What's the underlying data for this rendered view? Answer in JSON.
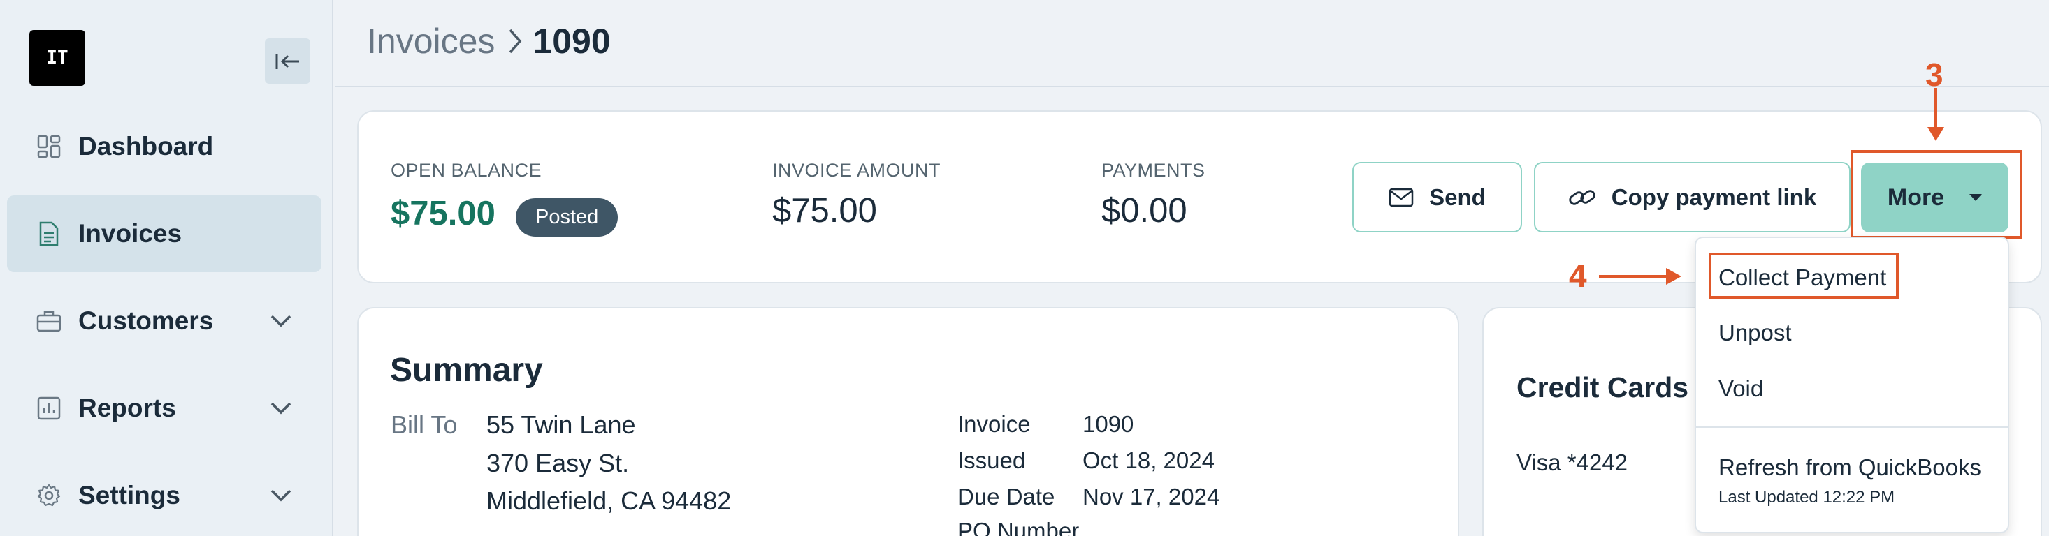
{
  "sidebar": {
    "logo_text": "IT",
    "items": [
      {
        "label": "Dashboard",
        "icon": "dashboard-icon"
      },
      {
        "label": "Invoices",
        "icon": "document-icon"
      },
      {
        "label": "Customers",
        "icon": "briefcase-icon"
      },
      {
        "label": "Reports",
        "icon": "chart-icon"
      },
      {
        "label": "Settings",
        "icon": "gear-icon"
      }
    ]
  },
  "header": {
    "breadcrumb_parent": "Invoices",
    "breadcrumb_current": "1090"
  },
  "balance": {
    "open_balance_label": "OPEN BALANCE",
    "open_balance_value": "$75.00",
    "status_badge": "Posted",
    "invoice_amount_label": "INVOICE AMOUNT",
    "invoice_amount_value": "$75.00",
    "payments_label": "PAYMENTS",
    "payments_value": "$0.00"
  },
  "actions": {
    "send_label": "Send",
    "copy_link_label": "Copy payment link",
    "more_label": "More"
  },
  "dropdown": {
    "items": [
      "Collect Payment",
      "Unpost",
      "Void",
      "Refresh from QuickBooks"
    ],
    "last_updated": "Last Updated 12:22 PM"
  },
  "annotations": {
    "step3": "3",
    "step4": "4"
  },
  "summary": {
    "title": "Summary",
    "bill_to_label": "Bill To",
    "address": [
      "55 Twin Lane",
      "370 Easy St.",
      "Middlefield, CA 94482"
    ],
    "details": [
      {
        "label": "Invoice",
        "value": "1090"
      },
      {
        "label": "Issued",
        "value": "Oct 18, 2024"
      },
      {
        "label": "Due Date",
        "value": "Nov 17, 2024"
      },
      {
        "label": "PO Number",
        "value": ""
      }
    ]
  },
  "credit_cards": {
    "title": "Credit Cards",
    "card": "Visa *4242"
  },
  "colors": {
    "accent": "#8fd3c6",
    "green_value": "#16745f",
    "annotation": "#e0582a",
    "badge": "#3f5666"
  }
}
